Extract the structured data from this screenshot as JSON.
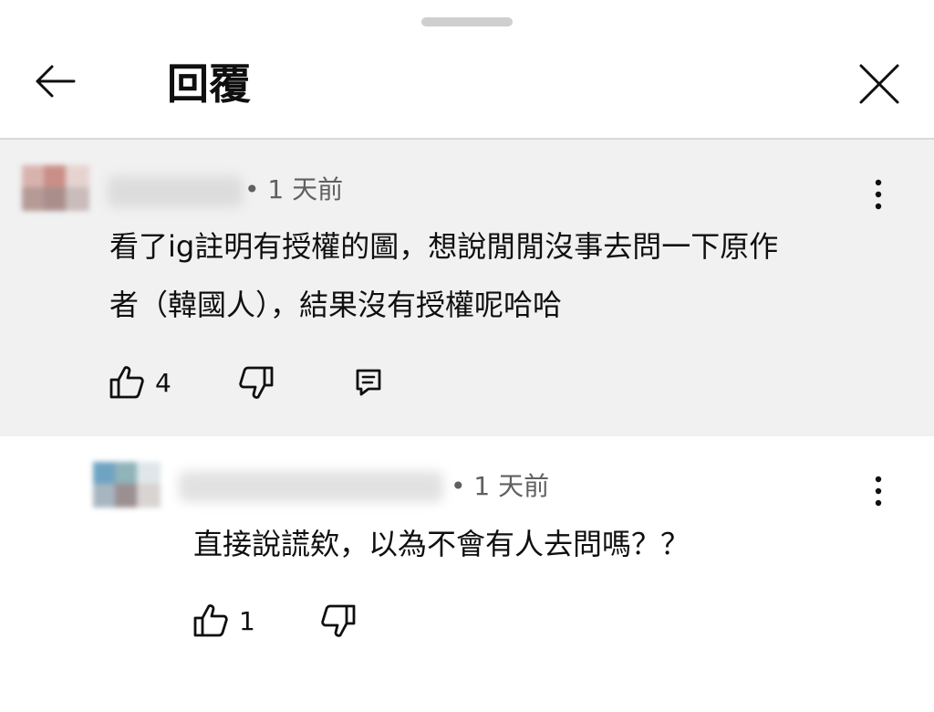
{
  "header": {
    "title": "回覆",
    "back_icon": "arrow-left-icon",
    "close_icon": "close-icon"
  },
  "comments": [
    {
      "time": "• 1 天前",
      "lines": [
        "看了ig註明有授權的圖，想說閒閒沒事去問一下原作",
        "者（韓國人），結果沒有授權呢哈哈"
      ],
      "likes": "4"
    },
    {
      "time": "• 1 天前",
      "lines": [
        "直接說謊欸，以為不會有人去問嗎？？"
      ],
      "likes": "1"
    }
  ],
  "colors": {
    "highlight_bg": "#f1f1f1",
    "text": "#0f0f0f",
    "secondary_text": "#606060"
  }
}
